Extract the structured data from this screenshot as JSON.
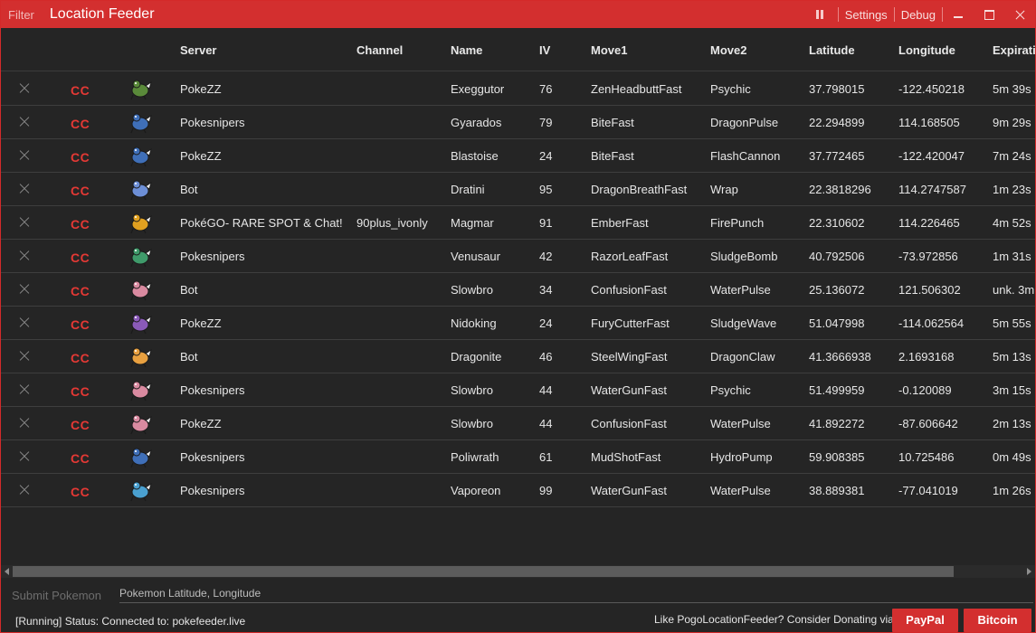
{
  "titlebar": {
    "filter_label": "Filter",
    "title": "Location Feeder",
    "settings_label": "Settings",
    "debug_label": "Debug"
  },
  "table": {
    "headers": [
      "Server",
      "Channel",
      "Name",
      "IV",
      "Move1",
      "Move2",
      "Latitude",
      "Longitude",
      "Expiration"
    ],
    "copy_label": "CC",
    "rows": [
      {
        "server": "PokeZZ",
        "channel": "",
        "name": "Exeggutor",
        "iv": "76",
        "move1": "ZenHeadbuttFast",
        "move2": "Psychic",
        "lat": "37.798015",
        "lng": "-122.450218",
        "exp": "5m 39s"
      },
      {
        "server": "Pokesnipers",
        "channel": "",
        "name": "Gyarados",
        "iv": "79",
        "move1": "BiteFast",
        "move2": "DragonPulse",
        "lat": "22.294899",
        "lng": "114.168505",
        "exp": "9m 29s"
      },
      {
        "server": "PokeZZ",
        "channel": "",
        "name": "Blastoise",
        "iv": "24",
        "move1": "BiteFast",
        "move2": "FlashCannon",
        "lat": "37.772465",
        "lng": "-122.420047",
        "exp": "7m 24s"
      },
      {
        "server": "Bot",
        "channel": "",
        "name": "Dratini",
        "iv": "95",
        "move1": "DragonBreathFast",
        "move2": "Wrap",
        "lat": "22.3818296",
        "lng": "114.2747587",
        "exp": "1m 23s"
      },
      {
        "server": "PokéGO- RARE SPOT & Chat!",
        "channel": "90plus_ivonly",
        "name": "Magmar",
        "iv": "91",
        "move1": "EmberFast",
        "move2": "FirePunch",
        "lat": "22.310602",
        "lng": "114.226465",
        "exp": "4m 52s"
      },
      {
        "server": "Pokesnipers",
        "channel": "",
        "name": "Venusaur",
        "iv": "42",
        "move1": "RazorLeafFast",
        "move2": "SludgeBomb",
        "lat": "40.792506",
        "lng": "-73.972856",
        "exp": "1m 31s"
      },
      {
        "server": "Bot",
        "channel": "",
        "name": "Slowbro",
        "iv": "34",
        "move1": "ConfusionFast",
        "move2": "WaterPulse",
        "lat": "25.136072",
        "lng": "121.506302",
        "exp": "unk. 3m"
      },
      {
        "server": "PokeZZ",
        "channel": "",
        "name": "Nidoking",
        "iv": "24",
        "move1": "FuryCutterFast",
        "move2": "SludgeWave",
        "lat": "51.047998",
        "lng": "-114.062564",
        "exp": "5m 55s"
      },
      {
        "server": "Bot",
        "channel": "",
        "name": "Dragonite",
        "iv": "46",
        "move1": "SteelWingFast",
        "move2": "DragonClaw",
        "lat": "41.3666938",
        "lng": "2.1693168",
        "exp": "5m 13s"
      },
      {
        "server": "Pokesnipers",
        "channel": "",
        "name": "Slowbro",
        "iv": "44",
        "move1": "WaterGunFast",
        "move2": "Psychic",
        "lat": "51.499959",
        "lng": "-0.120089",
        "exp": "3m 15s"
      },
      {
        "server": "PokeZZ",
        "channel": "",
        "name": "Slowbro",
        "iv": "44",
        "move1": "ConfusionFast",
        "move2": "WaterPulse",
        "lat": "41.892272",
        "lng": "-87.606642",
        "exp": "2m 13s"
      },
      {
        "server": "Pokesnipers",
        "channel": "",
        "name": "Poliwrath",
        "iv": "61",
        "move1": "MudShotFast",
        "move2": "HydroPump",
        "lat": "59.908385",
        "lng": "10.725486",
        "exp": "0m 49s"
      },
      {
        "server": "Pokesnipers",
        "channel": "",
        "name": "Vaporeon",
        "iv": "99",
        "move1": "WaterGunFast",
        "move2": "WaterPulse",
        "lat": "38.889381",
        "lng": "-77.041019",
        "exp": "1m 26s"
      }
    ]
  },
  "sprite_colors": [
    "#5a8a3a",
    "#3f6fb8",
    "#3f6fb8",
    "#6d8fd6",
    "#e0a020",
    "#3f9a6a",
    "#d98aa0",
    "#8a5ab8",
    "#e8a040",
    "#d98aa0",
    "#d98aa0",
    "#3f6fb8",
    "#4aa0d0"
  ],
  "bottom": {
    "submit_label": "Submit Pokemon",
    "submit_placeholder": "Pokemon Latitude, Longitude",
    "status_text": "[Running]  Status:  Connected to: pokefeeder.live",
    "donate_text": "Like PogoLocationFeeder? Consider Donating via",
    "paypal_label": "PayPal",
    "bitcoin_label": "Bitcoin"
  },
  "colors": {
    "accent": "#d32f2f",
    "background": "#252525",
    "cc_red": "#e53935"
  }
}
